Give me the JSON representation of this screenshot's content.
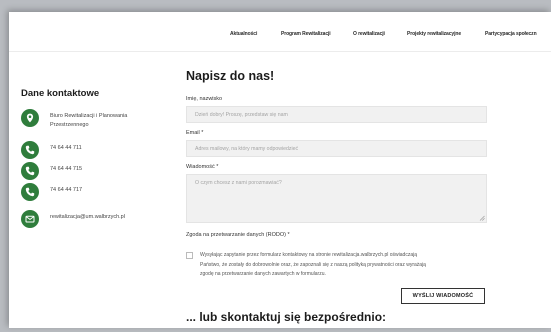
{
  "nav": {
    "items": [
      "Aktualności",
      "Program Rewitalizacji",
      "O rewitalizacji",
      "Projekty rewitalizacyjne",
      "Partycypacja społeczn"
    ]
  },
  "sidebar": {
    "title": "Dane kontaktowe",
    "office_line1": "Biuro Rewitalizacji i Planowania",
    "office_line2": "Przestrzennego",
    "phones": [
      "74 64 44 711",
      "74 64 44 715",
      "74 64 44 717"
    ],
    "email": "rewitalizacja@um.walbrzych.pl"
  },
  "form": {
    "title": "Napisz do nas!",
    "name_label": "Imię, nazwisko",
    "name_placeholder": "Dzień dobry! Proszę, przedstaw się nam",
    "email_label": "Email *",
    "email_placeholder": "Adres mailowy, na który mamy odpowiedzieć",
    "message_label": "Wiadomość *",
    "message_placeholder": "O czym chcesz z nami porozmawiać?",
    "consent_label": "Zgoda na przetwarzanie danych (RODO) *",
    "consent_line1": "Wysyłając zapytanie przez formularz kontaktowy na stronie rewitalizacja.walbrzych.pl oświadczają",
    "consent_line2": "Państwo, że zostały do dobrowolnie oraz, że zapoznali się z naszą polityką prywatności oraz wyrażają",
    "consent_line3": "zgodę na przetwarzanie danych zawartych w formularzu.",
    "submit_label": "WYŚLIJ WIADOMOŚĆ"
  },
  "contact_heading": "... lub skontaktuj się bezpośrednio:",
  "colors": {
    "accent": "#2f7d3c",
    "background": "#b9bcc1",
    "field_bg": "#f1f1f1"
  },
  "icons": {
    "location": "map-pin-icon",
    "phone": "phone-icon",
    "email": "envelope-icon"
  }
}
